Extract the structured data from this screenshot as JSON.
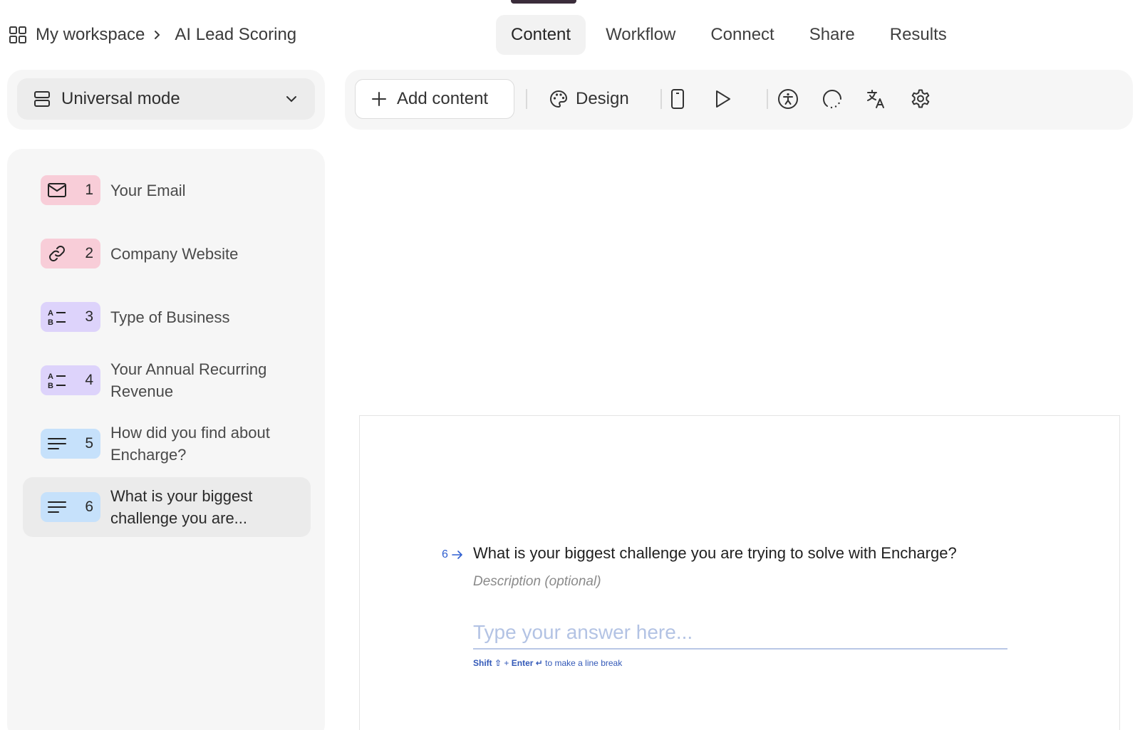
{
  "breadcrumb": {
    "workspace": "My workspace",
    "form_name": "AI Lead Scoring"
  },
  "tabs": [
    {
      "label": "Content",
      "active": true
    },
    {
      "label": "Workflow",
      "active": false
    },
    {
      "label": "Connect",
      "active": false
    },
    {
      "label": "Share",
      "active": false
    },
    {
      "label": "Results",
      "active": false
    }
  ],
  "mode_selector": {
    "label": "Universal mode",
    "icon": "layout-rows-icon"
  },
  "questions": [
    {
      "number": "1",
      "label": "Your Email",
      "icon": "envelope-icon",
      "color": "#f8cdd8",
      "selected": false
    },
    {
      "number": "2",
      "label": "Company Website",
      "icon": "link-icon",
      "color": "#f8cdd8",
      "selected": false
    },
    {
      "number": "3",
      "label": "Type of Business",
      "icon": "multiple-choice-icon",
      "color": "#ddd3fb",
      "selected": false
    },
    {
      "number": "4",
      "label": "Your Annual Recurring Revenue",
      "icon": "multiple-choice-icon",
      "color": "#ddd3fb",
      "selected": false
    },
    {
      "number": "5",
      "label": "How did you find about Encharge?",
      "icon": "long-text-icon",
      "color": "#c6e1fb",
      "selected": false
    },
    {
      "number": "6",
      "label": "What is your biggest challenge you are...",
      "icon": "long-text-icon",
      "color": "#c6e1fb",
      "selected": true
    }
  ],
  "toolbar": {
    "add_content_label": "Add content",
    "design_label": "Design",
    "icons": [
      "mobile-preview-icon",
      "play-icon",
      "accessibility-icon",
      "loading-icon",
      "translate-icon",
      "settings-gear-icon"
    ]
  },
  "editor": {
    "question_number": "6",
    "question_title": "What is your biggest challenge you are trying to solve with Encharge?",
    "description_placeholder": "Description (optional)",
    "answer_placeholder": "Type your answer here...",
    "hint_shift": "Shift ⇧",
    "hint_plus": " + ",
    "hint_enter": "Enter ↵",
    "hint_rest": " to make a line break"
  },
  "colors": {
    "accent_blue": "#2f5fd0",
    "pink_badge": "#f8cdd8",
    "purple_badge": "#ddd3fb",
    "blue_badge": "#c6e1fb"
  }
}
